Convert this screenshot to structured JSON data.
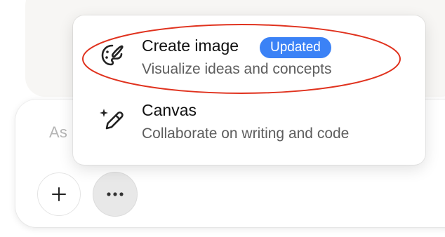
{
  "composer": {
    "placeholder_visible": "As"
  },
  "menu": {
    "items": [
      {
        "title": "Create image",
        "badge": "Updated",
        "subtitle": "Visualize ideas and concepts",
        "icon": "palette-brush-icon"
      },
      {
        "title": "Canvas",
        "subtitle": "Collaborate on writing and code",
        "icon": "sparkle-pencil-icon"
      }
    ]
  },
  "toolbar": {
    "plus_icon": "plus-icon",
    "more_icon": "more-horizontal-icon"
  },
  "colors": {
    "badge": "#3b82f6",
    "annotation": "#e0321e",
    "background_panel": "#f7f6f4"
  }
}
